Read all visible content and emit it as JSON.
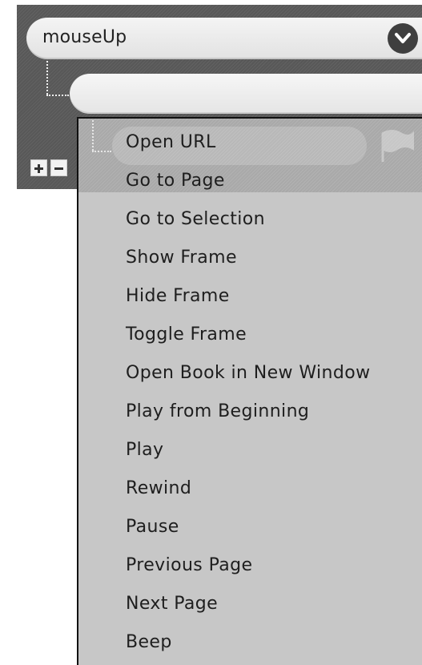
{
  "event_select": {
    "value": "mouseUp",
    "chevron_icon": "chevron-down-icon"
  },
  "action_select": {
    "value": "",
    "chevron_icon": "chevron-down-icon"
  },
  "buttons": {
    "add_icon": "plus-icon",
    "remove_icon": "minus-icon"
  },
  "menu": {
    "items": [
      {
        "label": "Open URL"
      },
      {
        "label": "Go to Page"
      },
      {
        "label": "Go to Selection"
      },
      {
        "label": "Show Frame"
      },
      {
        "label": "Hide Frame"
      },
      {
        "label": "Toggle Frame"
      },
      {
        "label": "Open Book in New Window"
      },
      {
        "label": "Play from Beginning"
      },
      {
        "label": "Play"
      },
      {
        "label": "Rewind"
      },
      {
        "label": "Pause"
      },
      {
        "label": "Previous Page"
      },
      {
        "label": "Next Page"
      },
      {
        "label": "Beep"
      }
    ],
    "flag_icon": "checkered-flag-icon"
  },
  "colors": {
    "panel": "#585858",
    "menu_background": "#c7c7c7",
    "menu_highlight": "#a9a9a9",
    "text": "#1e1e1e"
  }
}
